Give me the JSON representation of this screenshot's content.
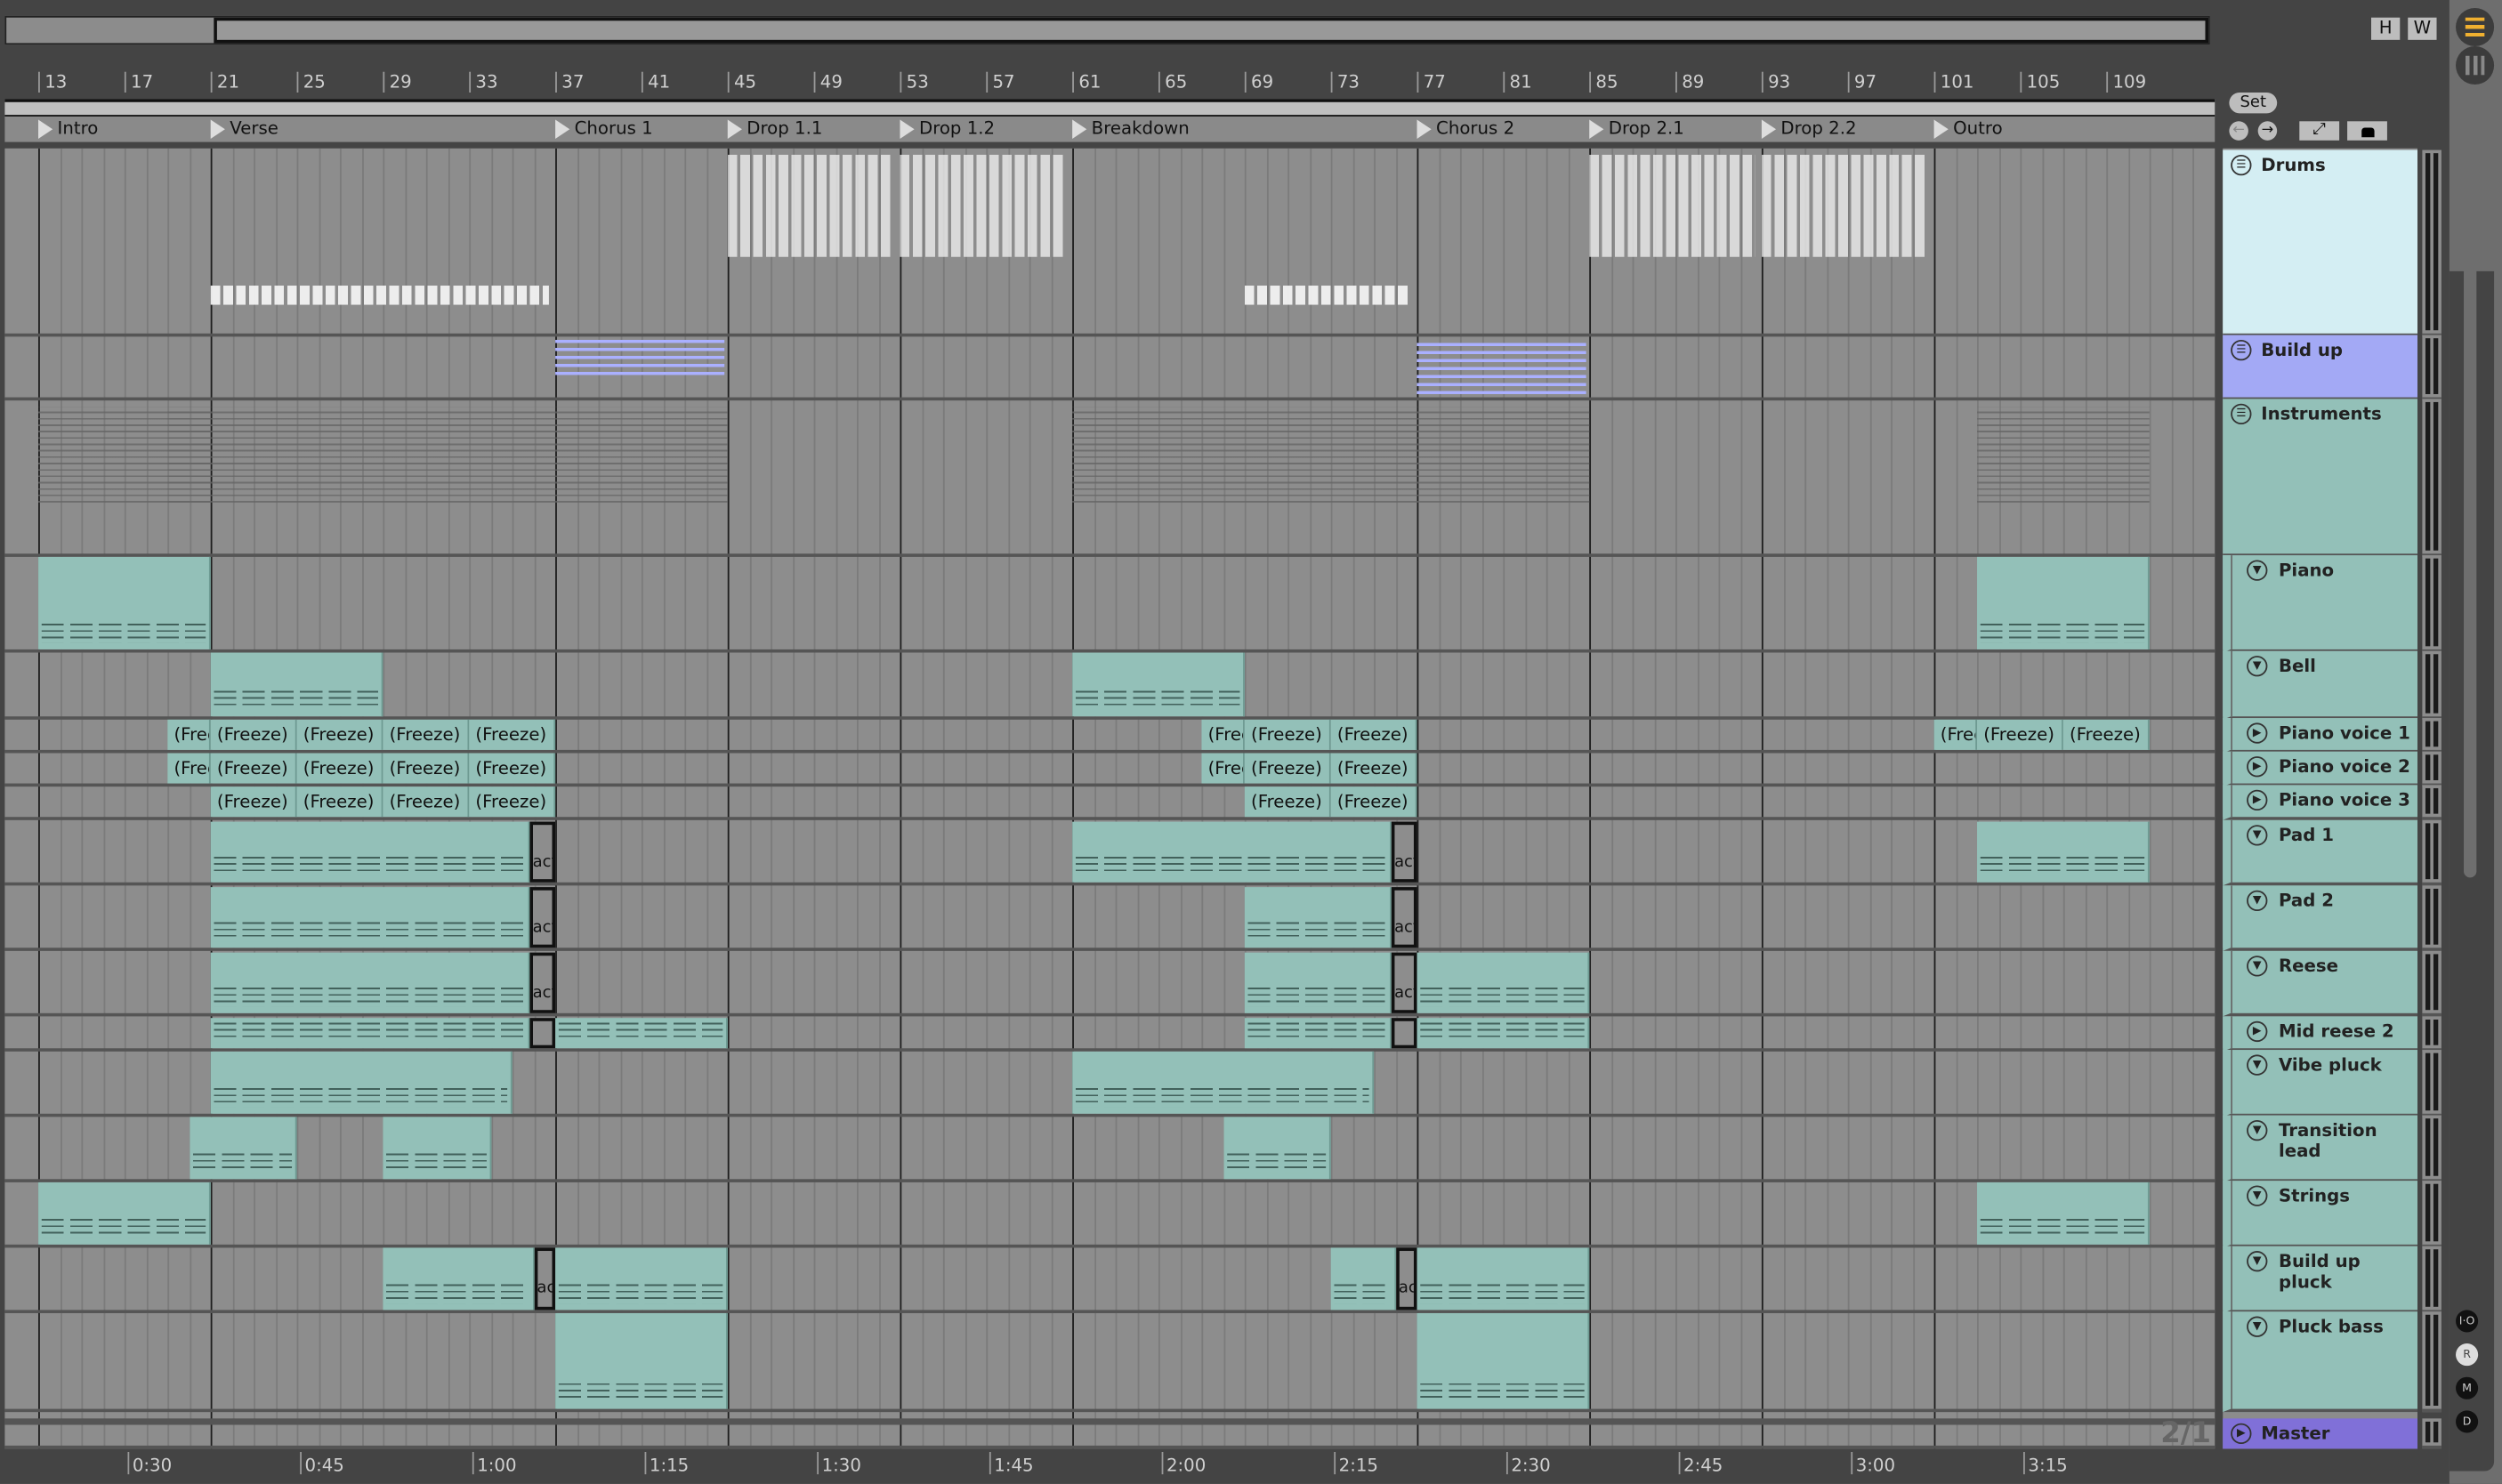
{
  "overview": {
    "h_button": "H",
    "w_button": "W"
  },
  "ruler": {
    "bars": [
      "13",
      "17",
      "21",
      "25",
      "29",
      "33",
      "37",
      "41",
      "45",
      "49",
      "53",
      "57",
      "61",
      "65",
      "69",
      "73",
      "77",
      "81",
      "85",
      "89",
      "93",
      "97",
      "101",
      "105",
      "109"
    ]
  },
  "locators": [
    {
      "name": "Intro",
      "bar": 13
    },
    {
      "name": "Verse",
      "bar": 21
    },
    {
      "name": "Chorus 1",
      "bar": 37
    },
    {
      "name": "Drop 1.1",
      "bar": 45
    },
    {
      "name": "Drop 1.2",
      "bar": 53
    },
    {
      "name": "Breakdown",
      "bar": 61
    },
    {
      "name": "Chorus 2",
      "bar": 77
    },
    {
      "name": "Drop 2.1",
      "bar": 85
    },
    {
      "name": "Drop 2.2",
      "bar": 93
    },
    {
      "name": "Outro",
      "bar": 101
    }
  ],
  "locator_controls": {
    "set_label": "Set",
    "prev_icon": "arrow-left-icon",
    "next_icon": "arrow-right-icon"
  },
  "tracks": [
    {
      "name": "Drums",
      "icon": "group",
      "color": "#d4eef3"
    },
    {
      "name": "Build up",
      "icon": "group",
      "color": "#a3a9f5"
    },
    {
      "name": "Instruments",
      "icon": "group",
      "color": "#93c0b8"
    },
    {
      "name": "Piano",
      "icon": "fold",
      "color": "#93c0b8"
    },
    {
      "name": "Bell",
      "icon": "fold",
      "color": "#93c0b8"
    },
    {
      "name": "Piano voice 1",
      "icon": "play",
      "color": "#93c0b8"
    },
    {
      "name": "Piano voice 2",
      "icon": "play",
      "color": "#93c0b8"
    },
    {
      "name": "Piano voice 3",
      "icon": "play",
      "color": "#93c0b8"
    },
    {
      "name": "Pad 1",
      "icon": "fold",
      "color": "#93c0b8"
    },
    {
      "name": "Pad 2",
      "icon": "fold",
      "color": "#93c0b8"
    },
    {
      "name": "Reese",
      "icon": "fold",
      "color": "#93c0b8"
    },
    {
      "name": "Mid reese 2",
      "icon": "play",
      "color": "#93c0b8"
    },
    {
      "name": "Vibe pluck",
      "icon": "fold",
      "color": "#93c0b8"
    },
    {
      "name": "Transition lead",
      "icon": "fold",
      "color": "#93c0b8"
    },
    {
      "name": "Strings",
      "icon": "fold",
      "color": "#93c0b8"
    },
    {
      "name": "Build up pluck",
      "icon": "fold",
      "color": "#93c0b8"
    },
    {
      "name": "Pluck bass",
      "icon": "fold",
      "color": "#93c0b8"
    }
  ],
  "master": {
    "name": "Master",
    "color": "#8070d8"
  },
  "clips": {
    "Piano": [
      {
        "s": 13,
        "e": 21
      },
      {
        "s": 103,
        "e": 111
      }
    ],
    "Bell": [
      {
        "s": 21,
        "e": 29
      },
      {
        "s": 61,
        "e": 69
      }
    ],
    "Piano voice 1": [
      {
        "s": 19,
        "e": 21,
        "label": "(Freeze)"
      },
      {
        "s": 21,
        "e": 25,
        "label": "(Freeze)"
      },
      {
        "s": 25,
        "e": 29,
        "label": "(Freeze)"
      },
      {
        "s": 29,
        "e": 33,
        "label": "(Freeze)"
      },
      {
        "s": 33,
        "e": 37,
        "label": "(Freeze)"
      },
      {
        "s": 67,
        "e": 69,
        "label": "(Freeze)"
      },
      {
        "s": 69,
        "e": 73,
        "label": "(Freeze)"
      },
      {
        "s": 73,
        "e": 77,
        "label": "(Freeze)"
      },
      {
        "s": 101,
        "e": 103,
        "label": "(Freeze)"
      },
      {
        "s": 103,
        "e": 107,
        "label": "(Freeze)"
      },
      {
        "s": 107,
        "e": 111,
        "label": "(Freeze)"
      }
    ],
    "Piano voice 2": [
      {
        "s": 19,
        "e": 21,
        "label": "(Freeze)"
      },
      {
        "s": 21,
        "e": 25,
        "label": "(Freeze)"
      },
      {
        "s": 25,
        "e": 29,
        "label": "(Freeze)"
      },
      {
        "s": 29,
        "e": 33,
        "label": "(Freeze)"
      },
      {
        "s": 33,
        "e": 37,
        "label": "(Freeze)"
      },
      {
        "s": 67,
        "e": 69,
        "label": "(Freeze)"
      },
      {
        "s": 69,
        "e": 73,
        "label": "(Freeze)"
      },
      {
        "s": 73,
        "e": 77,
        "label": "(Freeze)"
      }
    ],
    "Piano voice 3": [
      {
        "s": 21,
        "e": 25,
        "label": "(Freeze)"
      },
      {
        "s": 25,
        "e": 29,
        "label": "(Freeze)"
      },
      {
        "s": 29,
        "e": 33,
        "label": "(Freeze)"
      },
      {
        "s": 33,
        "e": 37,
        "label": "(Freeze)"
      },
      {
        "s": 69,
        "e": 73,
        "label": "(Freeze)"
      },
      {
        "s": 73,
        "e": 77,
        "label": "(Freeze)"
      }
    ],
    "Pad 1": [
      {
        "s": 21,
        "e": 35.8
      },
      {
        "s": 35.8,
        "e": 37,
        "act": "act"
      },
      {
        "s": 61,
        "e": 75.8
      },
      {
        "s": 75.8,
        "e": 77,
        "act": "act"
      },
      {
        "s": 103,
        "e": 111
      }
    ],
    "Pad 2": [
      {
        "s": 21,
        "e": 35.8
      },
      {
        "s": 35.8,
        "e": 37,
        "act": "act"
      },
      {
        "s": 69,
        "e": 75.8
      },
      {
        "s": 75.8,
        "e": 77,
        "act": "act"
      }
    ],
    "Reese": [
      {
        "s": 21,
        "e": 35.8
      },
      {
        "s": 35.8,
        "e": 37,
        "act": "act"
      },
      {
        "s": 69,
        "e": 75.8
      },
      {
        "s": 75.8,
        "e": 77,
        "act": "act"
      },
      {
        "s": 77,
        "e": 85
      }
    ],
    "Mid reese 2": [
      {
        "s": 21,
        "e": 35.8
      },
      {
        "s": 35.8,
        "e": 37,
        "act": ""
      },
      {
        "s": 37,
        "e": 45
      },
      {
        "s": 69,
        "e": 75.8
      },
      {
        "s": 75.8,
        "e": 77,
        "act": ""
      },
      {
        "s": 77,
        "e": 85
      }
    ],
    "Vibe pluck": [
      {
        "s": 21,
        "e": 35
      },
      {
        "s": 61,
        "e": 75
      }
    ],
    "Transition lead": [
      {
        "s": 20,
        "e": 25
      },
      {
        "s": 29,
        "e": 34
      },
      {
        "s": 68,
        "e": 73
      }
    ],
    "Strings": [
      {
        "s": 13,
        "e": 21
      },
      {
        "s": 103,
        "e": 111
      }
    ],
    "Build up pluck": [
      {
        "s": 29,
        "e": 36
      },
      {
        "s": 36,
        "e": 37,
        "act": "ac"
      },
      {
        "s": 37,
        "e": 45
      },
      {
        "s": 73,
        "e": 76
      },
      {
        "s": 76,
        "e": 77,
        "act": "ac"
      },
      {
        "s": 77,
        "e": 85
      }
    ],
    "Pluck bass": [
      {
        "s": 37,
        "e": 45
      },
      {
        "s": 77,
        "e": 85
      }
    ]
  },
  "drum_patterns": [
    {
      "s": 21,
      "e": 37
    },
    {
      "s": 45,
      "e": 53
    },
    {
      "s": 53,
      "e": 61
    },
    {
      "s": 69,
      "e": 77
    },
    {
      "s": 85,
      "e": 93
    },
    {
      "s": 93,
      "e": 101
    }
  ],
  "buildup_patterns": [
    {
      "s": 37,
      "e": 45
    },
    {
      "s": 77,
      "e": 85
    }
  ],
  "time_ruler": [
    "0:30",
    "0:45",
    "1:00",
    "1:15",
    "1:30",
    "1:45",
    "2:00",
    "2:15",
    "2:30",
    "2:45",
    "3:00",
    "3:15"
  ],
  "time_signature": "2/1",
  "side_buttons": [
    "I·O",
    "R",
    "M",
    "D"
  ]
}
